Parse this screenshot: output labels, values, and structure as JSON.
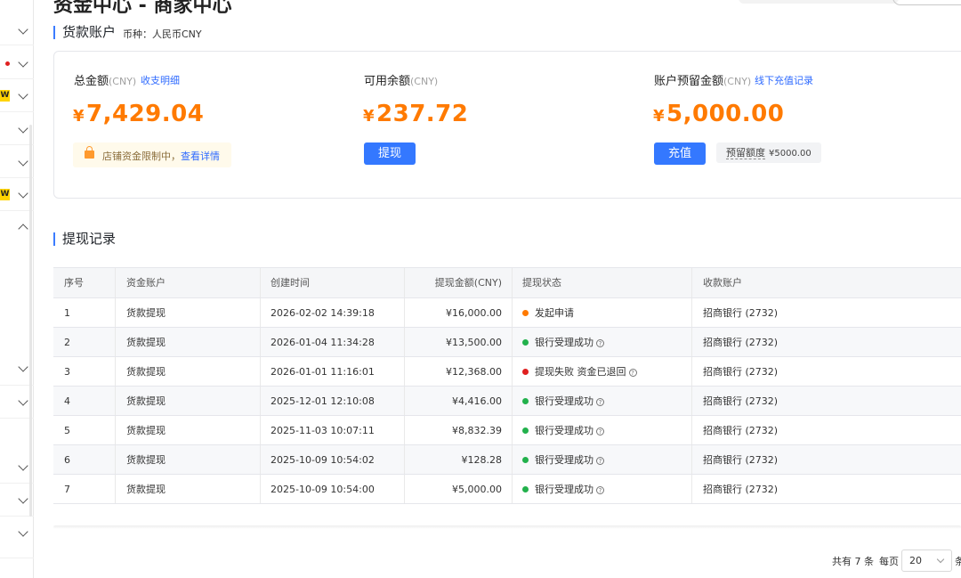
{
  "page": {
    "title_partial": "资金中心 - 商家中心"
  },
  "account_section": {
    "title": "货款账户",
    "currency_note": "币种：人民币CNY",
    "total": {
      "label": "总金额",
      "unit": "(CNY)",
      "link": "收支明细",
      "yen": "¥",
      "amount": "7,429.04"
    },
    "notice": {
      "text": "店铺资金限制中，",
      "link": "查看详情"
    },
    "available": {
      "label": "可用余额",
      "unit": "(CNY)",
      "yen": "¥",
      "amount": "237.72",
      "button": "提现"
    },
    "reserve": {
      "label": "账户预留金额",
      "unit": "(CNY)",
      "link": "线下充值记录",
      "yen": "¥",
      "amount": "5,000.00",
      "button": "充值",
      "quota_label": "预留额度",
      "quota_value": "¥5000.00"
    }
  },
  "withdraw_section": {
    "title": "提现记录",
    "columns": [
      "序号",
      "资金账户",
      "创建时间",
      "提现金额(CNY)",
      "提现状态",
      "收款账户"
    ],
    "rows": [
      {
        "no": "1",
        "account": "货款提现",
        "time": "2026-02-02 14:39:18",
        "amount": "¥16,000.00",
        "status": "发起申请",
        "status_color": "#ff7a00",
        "help": false,
        "payee": "招商银行 (2732)"
      },
      {
        "no": "2",
        "account": "货款提现",
        "time": "2026-01-04 11:34:28",
        "amount": "¥13,500.00",
        "status": "银行受理成功",
        "status_color": "#22b14c",
        "help": true,
        "payee": "招商银行 (2732)"
      },
      {
        "no": "3",
        "account": "货款提现",
        "time": "2026-01-01 11:16:01",
        "amount": "¥12,368.00",
        "status": "提现失败 资金已退回",
        "status_color": "#e02020",
        "help": true,
        "payee": "招商银行 (2732)"
      },
      {
        "no": "4",
        "account": "货款提现",
        "time": "2025-12-01 12:10:08",
        "amount": "¥4,416.00",
        "status": "银行受理成功",
        "status_color": "#22b14c",
        "help": true,
        "payee": "招商银行 (2732)"
      },
      {
        "no": "5",
        "account": "货款提现",
        "time": "2025-11-03 10:07:11",
        "amount": "¥8,832.39",
        "status": "银行受理成功",
        "status_color": "#22b14c",
        "help": true,
        "payee": "招商银行 (2732)"
      },
      {
        "no": "6",
        "account": "货款提现",
        "time": "2025-10-09 10:54:02",
        "amount": "¥128.28",
        "status": "银行受理成功",
        "status_color": "#22b14c",
        "help": true,
        "payee": "招商银行 (2732)"
      },
      {
        "no": "7",
        "account": "货款提现",
        "time": "2025-10-09 10:54:00",
        "amount": "¥5,000.00",
        "status": "银行受理成功",
        "status_color": "#22b14c",
        "help": true,
        "payee": "招商银行 (2732)"
      }
    ]
  },
  "pagination": {
    "total_text": "共有 7 条",
    "per_page_label": "每页",
    "page_size": "20",
    "suffix": "条"
  },
  "sidebar": {
    "badge_text": "W",
    "help_glyph": "?"
  }
}
